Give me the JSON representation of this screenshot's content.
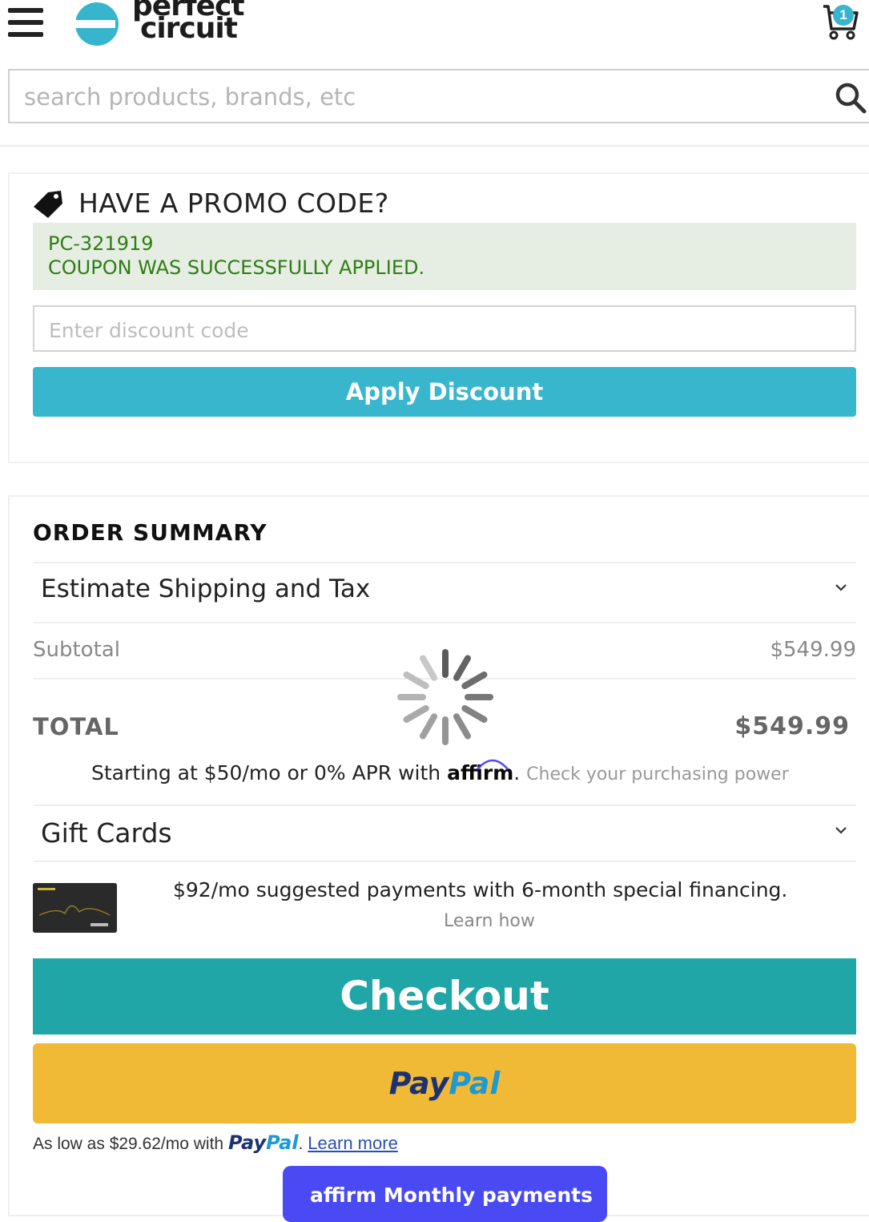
{
  "header": {
    "logo_line1": "perfect",
    "logo_line2": "circuit",
    "cart_count": "1",
    "icons": [
      "menu-icon",
      "logo-icon",
      "cart-icon",
      "search-icon"
    ]
  },
  "search": {
    "placeholder": "search products, brands, etc",
    "value": ""
  },
  "promo": {
    "title": "HAVE A PROMO CODE?",
    "applied_code": "PC-321919",
    "success_message": "COUPON WAS SUCCESSFULLY APPLIED.",
    "input_placeholder": "Enter discount code",
    "input_value": "",
    "apply_label": "Apply Discount",
    "icon": "tag-icon"
  },
  "summary": {
    "title": "ORDER SUMMARY",
    "shipping_label": "Estimate Shipping and Tax",
    "subtotal_label": "Subtotal",
    "subtotal_value": "$549.99",
    "total_label": "TOTAL",
    "total_value": "$549.99",
    "affirm_prefix": "Starting at $50/mo or 0% APR with",
    "affirm_brand": "affirm",
    "affirm_suffix": ".",
    "affirm_link": "Check your purchasing power",
    "gift_cards_label": "Gift Cards",
    "financing_text": "$92/mo suggested payments with 6-month special financing.",
    "financing_link": "Learn how"
  },
  "actions": {
    "checkout_label": "Checkout",
    "paypal_pay": "Pay",
    "paypal_pal": "Pal",
    "paypal_line_prefix": "As low as $29.62/mo with",
    "paypal_line_suffix": ".",
    "paypal_learn_more": "Learn more",
    "affirm_button_brand": "affirm",
    "affirm_button_label": "Monthly payments"
  },
  "colors": {
    "accent": "#38b6cd",
    "checkout": "#20a6a6",
    "paypal_button": "#f0ba37",
    "success_bg": "#e6eee3",
    "success_text": "#2e7d14",
    "affirm_button": "#4a4af4"
  }
}
